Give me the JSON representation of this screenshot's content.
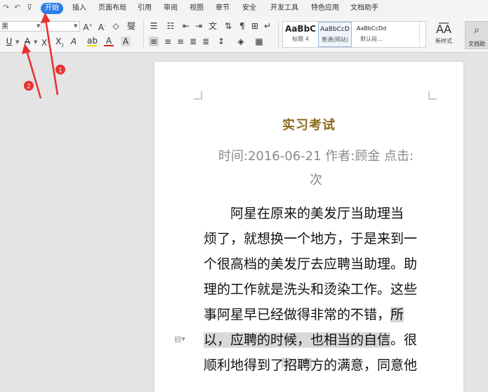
{
  "menu": {
    "tabs": [
      {
        "label": "开始",
        "active": true
      },
      {
        "label": "插入"
      },
      {
        "label": "页面布局"
      },
      {
        "label": "引用"
      },
      {
        "label": "审阅"
      },
      {
        "label": "视图"
      },
      {
        "label": "章节"
      },
      {
        "label": "安全"
      },
      {
        "label": "开发工具"
      },
      {
        "label": "特色应用"
      },
      {
        "label": "文档助手"
      }
    ]
  },
  "ribbon": {
    "font_name": "黑",
    "styles": [
      {
        "sample": "AaBbC",
        "name": "标题 4"
      },
      {
        "sample": "AaBbCcD",
        "name": "普通(网站)"
      },
      {
        "sample": "AaBbCcDd",
        "name": "默认段..."
      }
    ],
    "new_style_label": "新样式",
    "assistant_label": "文档助"
  },
  "document": {
    "title": "实习考试",
    "meta_line1": "时间:2016-06-21  作者:顾金  点击:",
    "meta_line2": "次",
    "body_lines": [
      "阿星在原来的美发厅当助理当",
      "烦了，就想换一个地方，于是来到一",
      "个很高档的美发厅去应聘当助理。助",
      "理的工作就是洗头和烫染工作。这些"
    ],
    "line5_plain": "事阿星早已经做得非常的不错，",
    "line5_highlight": "所",
    "line6_highlight": "以，应聘的时候，也相当的自信",
    "line6_plain": "。很",
    "line7": "顺利地得到了招聘方的满意，同意他"
  },
  "watermark": "限公司",
  "annotations": [
    "1",
    "2"
  ],
  "colors": {
    "accent": "#2b7de9",
    "title": "#8c6a1a",
    "annotation": "#e8302f"
  }
}
